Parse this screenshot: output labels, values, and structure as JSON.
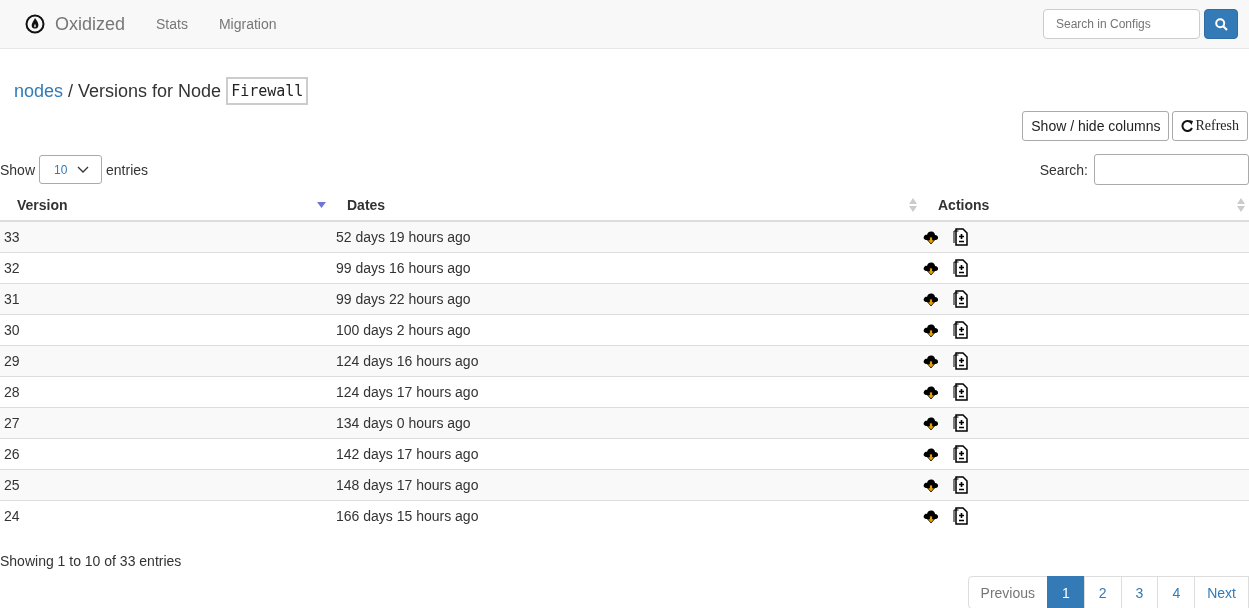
{
  "navbar": {
    "brand": "Oxidized",
    "links": [
      {
        "label": "Stats"
      },
      {
        "label": "Migration"
      }
    ],
    "search": {
      "placeholder": "Search in Configs"
    }
  },
  "breadcrumb": {
    "link": "nodes",
    "text": "/ Versions for Node",
    "node": "Firewall"
  },
  "toolbar": {
    "buttons": [
      "Show / hide columns",
      "Refresh"
    ]
  },
  "length": {
    "label_before": "Show",
    "value": "10",
    "label_after": "entries"
  },
  "filter": {
    "label": "Search:"
  },
  "table": {
    "columns": [
      {
        "label": "Version",
        "sorted": true
      },
      {
        "label": "Dates",
        "sorted": false
      },
      {
        "label": "Actions",
        "sorted": false
      }
    ],
    "rows": [
      {
        "version": "33",
        "date": "52 days 19 hours ago"
      },
      {
        "version": "32",
        "date": "99 days 16 hours ago"
      },
      {
        "version": "31",
        "date": "99 days 22 hours ago"
      },
      {
        "version": "30",
        "date": "100 days 2 hours ago"
      },
      {
        "version": "29",
        "date": "124 days 16 hours ago"
      },
      {
        "version": "28",
        "date": "124 days 17 hours ago"
      },
      {
        "version": "27",
        "date": "134 days 0 hours ago"
      },
      {
        "version": "26",
        "date": "142 days 17 hours ago"
      },
      {
        "version": "25",
        "date": "148 days 17 hours ago"
      },
      {
        "version": "24",
        "date": "166 days 15 hours ago"
      }
    ]
  },
  "info": "Showing 1 to 10 of 33 entries",
  "pagination": {
    "previous": {
      "label": "Previous",
      "disabled": true
    },
    "pages": [
      {
        "label": "1",
        "selected": true
      },
      {
        "label": "2",
        "selected": false
      },
      {
        "label": "3",
        "selected": false
      },
      {
        "label": "4",
        "selected": false
      }
    ],
    "next": {
      "label": "Next",
      "disabled": false
    }
  }
}
